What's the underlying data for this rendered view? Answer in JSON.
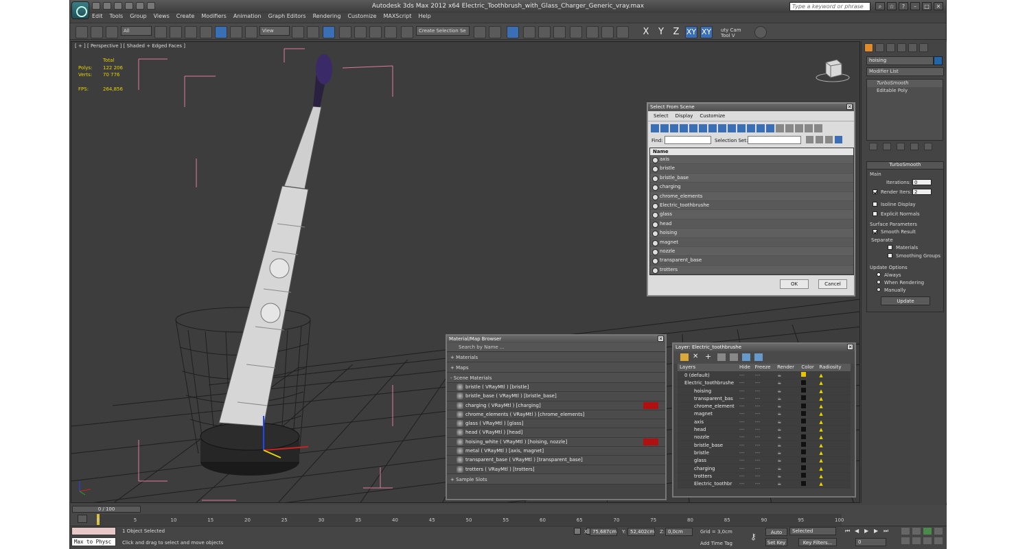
{
  "titlebar": {
    "title": "Autodesk 3ds Max  2012 x64      Electric_Toothbrush_with_Glass_Charger_Generic_vray.max",
    "search_placeholder": "Type a keyword or phrase"
  },
  "menu": [
    "Edit",
    "Tools",
    "Group",
    "Views",
    "Create",
    "Modifiers",
    "Animation",
    "Graph Editors",
    "Rendering",
    "Customize",
    "MAXScript",
    "Help"
  ],
  "toolbar": {
    "filter_dd": "All",
    "refcoord_dd": "View",
    "selset_dd": "Create Selection Se",
    "axis_x": "X",
    "axis_y": "Y",
    "axis_z": "Z",
    "axis_xy": "XY",
    "axis_xy2": "XY",
    "cam_tool": "uty Cam Tool V"
  },
  "viewport": {
    "label": "[ + ] [ Perspective ] [ Shaded + Edged Faces ]",
    "stats": {
      "total_label": "Total",
      "polys_label": "Polys:",
      "polys_value": "122 206",
      "verts_label": "Verts:",
      "verts_value": "70 776",
      "fps_label": "FPS:",
      "fps_value": "264,856"
    }
  },
  "command_panel": {
    "object_name": "hoising",
    "modifier_list": "Modifier List",
    "stack": [
      "TurboSmooth",
      "Editable Poly"
    ],
    "turbosmooth": {
      "title": "TurboSmooth",
      "main": "Main",
      "iterations_label": "Iterations:",
      "iterations_value": "0",
      "render_iters_label": "Render Iters:",
      "render_iters_value": "2",
      "isoline": "Isoline Display",
      "explicit": "Explicit Normals",
      "surface_params": "Surface Parameters",
      "smooth_result": "Smooth Result",
      "separate": "Separate",
      "materials": "Materials",
      "smoothing_groups": "Smoothing Groups",
      "update_options": "Update Options",
      "always": "Always",
      "when_rendering": "When Rendering",
      "manually": "Manually",
      "update_btn": "Update"
    }
  },
  "select_from_scene": {
    "title": "Select From Scene",
    "menu": [
      "Select",
      "Display",
      "Customize"
    ],
    "find_label": "Find:",
    "selection_set_label": "Selection Set:",
    "column": "Name",
    "items": [
      "axis",
      "bristle",
      "bristle_base",
      "charging",
      "chrome_elements",
      "Electric_toothbrushe",
      "glass",
      "head",
      "hoising",
      "magnet",
      "nozzle",
      "transparent_base",
      "trotters"
    ],
    "ok": "OK",
    "cancel": "Cancel"
  },
  "material_browser": {
    "title": "Material/Map Browser",
    "search": "Search by Name ...",
    "materials_section": "+ Materials",
    "maps_section": "+ Maps",
    "scene_section": "- Scene Materials",
    "items": [
      "bristle  ( VRayMtl ) [bristle]",
      "bristle_base  ( VRayMtl ) [bristle_base]",
      "charging  ( VRayMtl ) [charging]",
      "chrome_elements  ( VRayMtl ) [chrome_elements]",
      "glass  ( VRayMtl ) [glass]",
      "head  ( VRayMtl ) [head]",
      "hoising_white  ( VRayMtl ) [hoising, nozzle]",
      "metal  ( VRayMtl ) [axis, magnet]",
      "transparent_base  ( VRayMtl ) [transparent_base]",
      "trotters  ( VRayMtl ) [trotters]"
    ],
    "sample_slots": "+ Sample Slots"
  },
  "layer_dialog": {
    "title": "Layer: Electric_toothbrushe",
    "columns": [
      "Layers",
      "Hide",
      "Freeze",
      "Render",
      "Color",
      "Radiosity"
    ],
    "rows": [
      "0 (default)",
      "Electric_toothbrushe",
      "hoising",
      "transparent_bas",
      "chrome_element",
      "magnet",
      "axis",
      "head",
      "nozzle",
      "bristle_base",
      "bristle",
      "glass",
      "charging",
      "trotters",
      "Electric_toothbr"
    ]
  },
  "timeline": {
    "slider": "0 / 100",
    "ticks": [
      "0",
      "5",
      "10",
      "15",
      "20",
      "25",
      "30",
      "35",
      "40",
      "45",
      "50",
      "55",
      "60",
      "65",
      "70",
      "75",
      "80",
      "85",
      "90",
      "95",
      "100"
    ]
  },
  "status": {
    "maxscript": "Max to Physc",
    "selected": "1 Object Selected",
    "prompt": "Click and drag to select and move objects",
    "x_label": "X:",
    "x_value": "75,687cm",
    "y_label": "Y:",
    "y_value": "52,402cm",
    "z_label": "Z:",
    "z_value": "0,0cm",
    "grid": "Grid = 3,0cm",
    "add_time_tag": "Add Time Tag",
    "auto_key": "Auto Key",
    "set_key": "Set Key",
    "selected_dd": "Selected",
    "key_filters": "Key Filters...",
    "frame": "0"
  },
  "colors": {
    "accent": "#3b6fb5",
    "viewport_bg": "#3d3d3d",
    "stats_yellow": "#e8d400"
  }
}
